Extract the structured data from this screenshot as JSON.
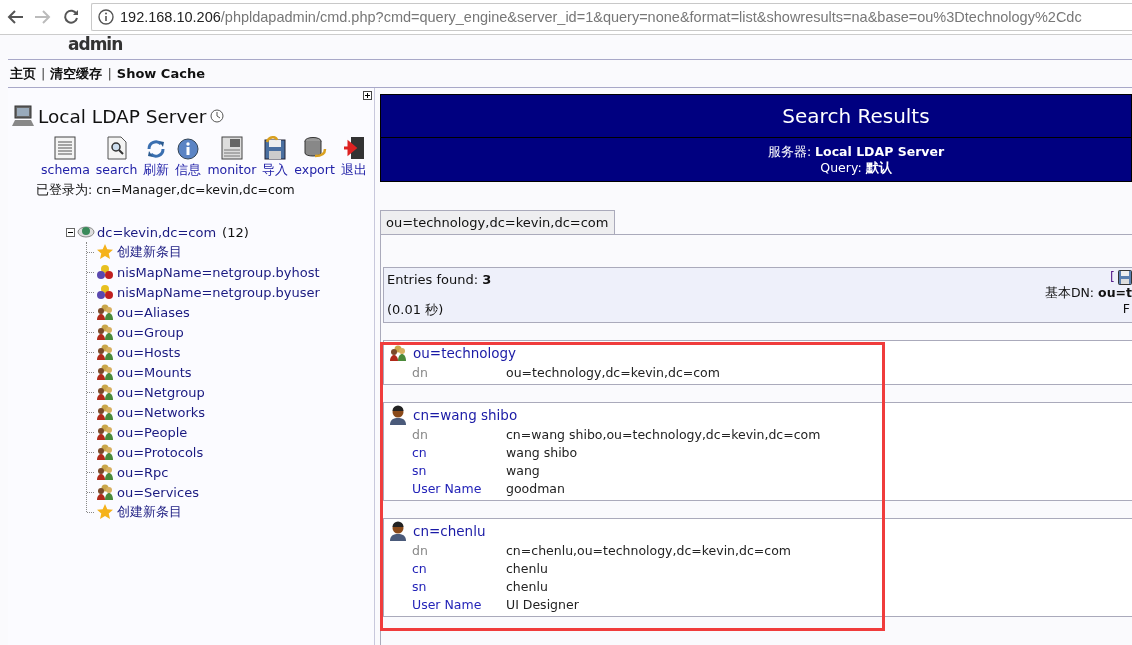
{
  "browser": {
    "nav": [
      {
        "kind": "back",
        "disabled": false
      },
      {
        "kind": "forward",
        "disabled": true
      },
      {
        "kind": "reload",
        "disabled": false
      }
    ],
    "address": {
      "host": "192.168.10.206",
      "path": "/phpldapadmin/cmd.php?cmd=query_engine&server_id=1&query=none&format=list&showresults=na&base=ou%3Dtechnology%2Cdc"
    }
  },
  "logo": "admin",
  "menu": [
    {
      "kind": "link",
      "label": "主页"
    },
    {
      "kind": "separator",
      "label": "|"
    },
    {
      "kind": "link",
      "label": "清空缓存"
    },
    {
      "kind": "separator",
      "label": "|"
    },
    {
      "kind": "link",
      "label": "Show Cache"
    }
  ],
  "server": {
    "title": "Local LDAP Server",
    "tools": [
      {
        "kind": "schema",
        "label": "schema"
      },
      {
        "kind": "search",
        "label": "search"
      },
      {
        "kind": "refresh",
        "label": "刷新"
      },
      {
        "kind": "info",
        "label": "信息"
      },
      {
        "kind": "monitor",
        "label": "monitor"
      },
      {
        "kind": "import",
        "label": "导入"
      },
      {
        "kind": "export",
        "label": "export"
      },
      {
        "kind": "logout",
        "label": "退出"
      }
    ],
    "logged_in": "已登录为: cn=Manager,dc=kevin,dc=com"
  },
  "tree": {
    "label": "dc=kevin,dc=com",
    "count": "(12)",
    "expanded": true,
    "children": [
      {
        "kind": "create",
        "label": "创建新条目"
      },
      {
        "kind": "nismap",
        "label": "nisMapName=netgroup.byhost"
      },
      {
        "kind": "nismap",
        "label": "nisMapName=netgroup.byuser"
      },
      {
        "kind": "ou",
        "label": "ou=Aliases"
      },
      {
        "kind": "ou",
        "label": "ou=Group"
      },
      {
        "kind": "ou",
        "label": "ou=Hosts"
      },
      {
        "kind": "ou",
        "label": "ou=Mounts"
      },
      {
        "kind": "ou",
        "label": "ou=Netgroup"
      },
      {
        "kind": "ou",
        "label": "ou=Networks"
      },
      {
        "kind": "ou",
        "label": "ou=People"
      },
      {
        "kind": "ou",
        "label": "ou=Protocols"
      },
      {
        "kind": "ou",
        "label": "ou=Rpc"
      },
      {
        "kind": "ou",
        "label": "ou=Services"
      },
      {
        "kind": "create",
        "label": "创建新条目"
      }
    ]
  },
  "results": {
    "title": "Search Results",
    "server_line": "服务器: **Local LDAP Server**",
    "query_line": "Query: **默认**"
  },
  "tabs": [
    {
      "label": "ou=technology,dc=kevin,dc=com",
      "selected": true
    }
  ],
  "summary": {
    "entries_found": "Entries found: **3**",
    "time": "(0.01 秒)",
    "bracket": "[",
    "base_dn": "基本DN: **ou=t**",
    "column_3": "F"
  },
  "entries": [
    {
      "kind": "ou",
      "title": "ou=technology",
      "attributes": [
        {
          "kind": "dn",
          "name": "dn",
          "value": "ou=technology,dc=kevin,dc=com"
        }
      ]
    },
    {
      "kind": "person",
      "title": "cn=wang shibo",
      "attributes": [
        {
          "kind": "dn",
          "name": "dn",
          "value": "cn=wang shibo,ou=technology,dc=kevin,dc=com"
        },
        {
          "kind": "attr",
          "name": "cn",
          "value": "wang shibo"
        },
        {
          "kind": "attr",
          "name": "sn",
          "value": "wang"
        },
        {
          "kind": "attr",
          "name": "User Name",
          "value": "goodman"
        }
      ]
    },
    {
      "kind": "person",
      "title": "cn=chenlu",
      "attributes": [
        {
          "kind": "dn",
          "name": "dn",
          "value": "cn=chenlu,ou=technology,dc=kevin,dc=com"
        },
        {
          "kind": "attr",
          "name": "cn",
          "value": "chenlu"
        },
        {
          "kind": "attr",
          "name": "sn",
          "value": "chenlu"
        },
        {
          "kind": "attr",
          "name": "User Name",
          "value": "UI Designer"
        }
      ]
    }
  ]
}
